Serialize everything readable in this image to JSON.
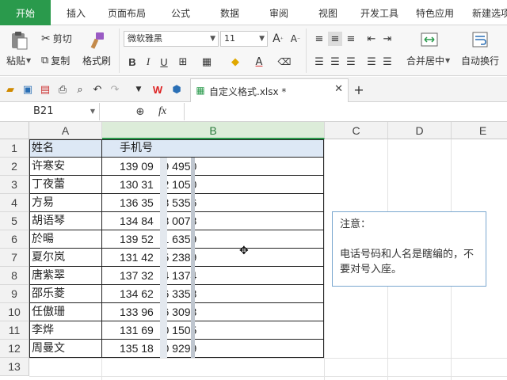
{
  "menu": {
    "tabs": [
      "开始",
      "插入",
      "页面布局",
      "公式",
      "数据",
      "审阅",
      "视图",
      "开发工具",
      "特色应用",
      "新建选项"
    ],
    "active": "开始"
  },
  "ribbon": {
    "paste": "粘贴",
    "cut": "剪切",
    "copy": "复制",
    "format_painter": "格式刷",
    "font_name": "微软雅黑",
    "font_size": "11",
    "bold": "B",
    "italic": "I",
    "underline": "U",
    "merge_center": "合并居中",
    "auto_wrap": "自动换行"
  },
  "document": {
    "tab_title": "自定义格式.xlsx *"
  },
  "formula_bar": {
    "name_box": "B21",
    "fx_label": "fx"
  },
  "sheet": {
    "columns": [
      "A",
      "B",
      "C",
      "D",
      "E"
    ],
    "rows": [
      "1",
      "2",
      "3",
      "4",
      "5",
      "6",
      "7",
      "8",
      "9",
      "10",
      "11",
      "12",
      "13"
    ],
    "header": {
      "name": "姓名",
      "phone": "手机号"
    },
    "records": [
      {
        "name": "许寒安",
        "phone": "139 09   9 4950"
      },
      {
        "name": "丁夜蕾",
        "phone": "130 31   2 1050"
      },
      {
        "name": "方易",
        "phone": "136 35   3 5356"
      },
      {
        "name": "胡语琴",
        "phone": "134 84   8 0078"
      },
      {
        "name": "於暘",
        "phone": "139 52   1 6359"
      },
      {
        "name": "夏尔岚",
        "phone": "131 42   5 2389"
      },
      {
        "name": "唐紫翠",
        "phone": "137 32   4 1374"
      },
      {
        "name": "邵乐菱",
        "phone": "134 62   6 3358"
      },
      {
        "name": "任傲珊",
        "phone": "133 96   6 3093"
      },
      {
        "name": "李烨",
        "phone": "131 69   0 1505"
      },
      {
        "name": "周曼文",
        "phone": "135 18   0 9299"
      }
    ]
  },
  "comment": {
    "title": "注意：",
    "body": "电话号码和人名是瞎编的，不要对号入座。"
  },
  "colors": {
    "accent": "#2a9a4c",
    "selected_column": "#dcecd9",
    "comment_border": "#7aa7cf"
  }
}
